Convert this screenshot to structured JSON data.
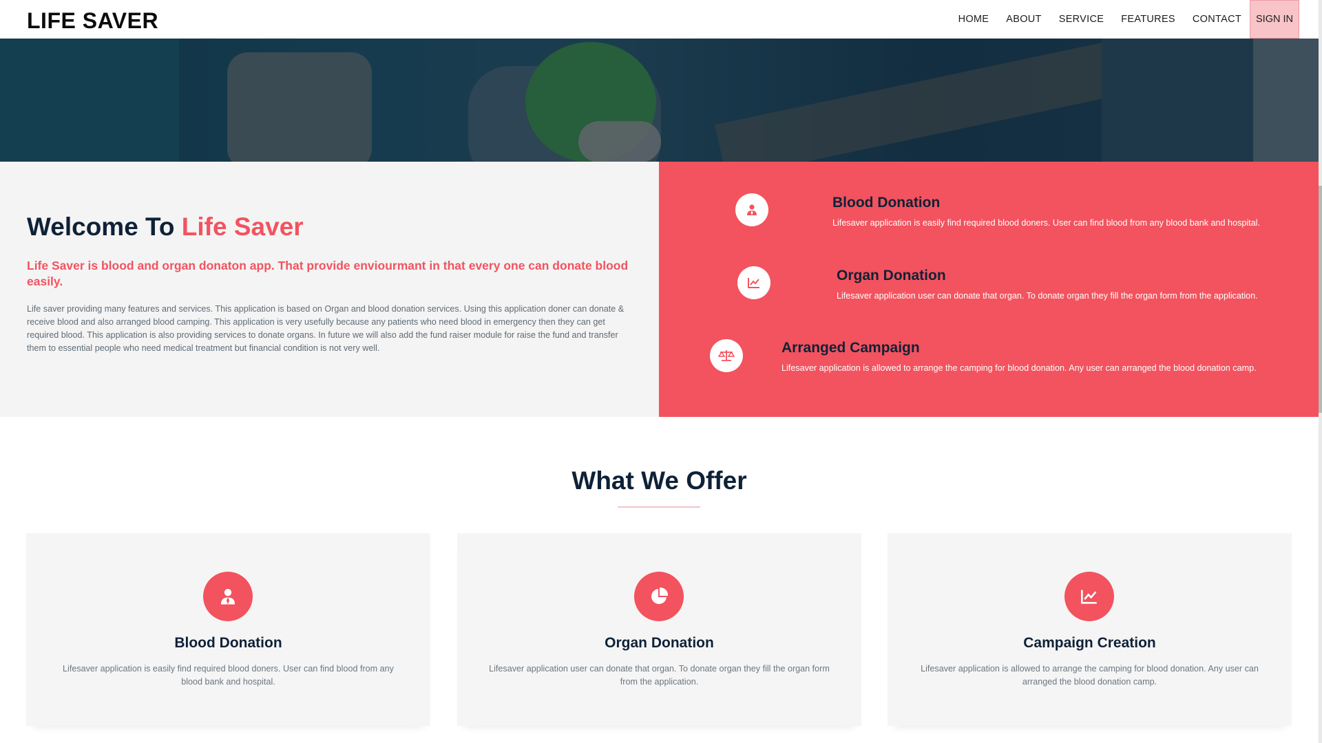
{
  "brand": {
    "name": "LIFE SAVER",
    "accent_color": "#f25360",
    "dark_color": "#0f2137"
  },
  "nav": {
    "items": [
      {
        "label": "HOME"
      },
      {
        "label": "ABOUT"
      },
      {
        "label": "SERVICE"
      },
      {
        "label": "FEATURES"
      },
      {
        "label": "CONTACT"
      }
    ],
    "signin_label": "SIGN IN"
  },
  "welcome": {
    "title_prefix": "Welcome To",
    "title_accent": "Life Saver",
    "lead": "Life Saver is blood and organ donaton app. That provide enviourmant in that every one can donate blood easily.",
    "body": "Life saver providing many features and services. This application is based on Organ and blood donation services. Using this application doner can donate & receive blood and also arranged blood camping. This application is very usefully because any patients who need blood in emergency then they can get required blood. This application is also providing services to donate organs. In future we will also add the fund raiser module for raise the fund and transfer them to essential people who need medical treatment but financial condition is not very well."
  },
  "features": [
    {
      "icon": "user-icon",
      "title": "Blood Donation",
      "text": "Lifesaver application is easily find required blood doners. User can find blood from any blood bank and hospital."
    },
    {
      "icon": "chart-line-icon",
      "title": "Organ Donation",
      "text": "Lifesaver application user can donate that organ. To donate organ they fill the organ form from the application."
    },
    {
      "icon": "balance-scale-icon",
      "title": "Arranged Campaign",
      "text": "Lifesaver application is allowed to arrange the camping for blood donation. Any user can arranged the blood donation camp."
    }
  ],
  "offer": {
    "title": "What We Offer",
    "cards": [
      {
        "icon": "user-icon",
        "title": "Blood Donation",
        "text": "Lifesaver application is easily find required blood doners. User can find blood from any blood bank and hospital."
      },
      {
        "icon": "pie-chart-icon",
        "title": "Organ Donation",
        "text": "Lifesaver application user can donate that organ. To donate organ they fill the organ form from the application."
      },
      {
        "icon": "chart-line-icon",
        "title": "Campaign Creation",
        "text": "Lifesaver application is allowed to arrange the camping for blood donation. Any user can arranged the blood donation camp."
      }
    ]
  }
}
